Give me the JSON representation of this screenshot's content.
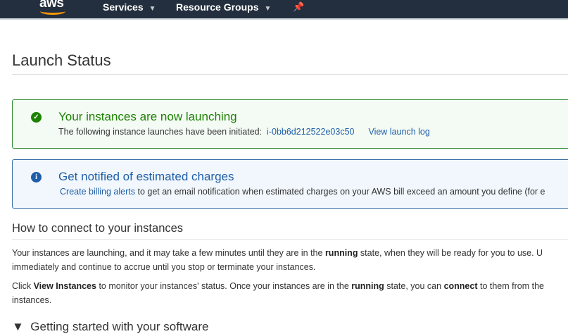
{
  "nav": {
    "logo": "aws",
    "services": "Services",
    "resource_groups": "Resource Groups"
  },
  "page_title": "Launch Status",
  "success": {
    "title": "Your instances are now launching",
    "text": "The following instance launches have been initiated:",
    "instance_id": "i-0bb6d212522e03c50",
    "log_link": "View launch log",
    "color": "#1d8102"
  },
  "billing": {
    "title": "Get notified of estimated charges",
    "link": "Create billing alerts",
    "text": " to get an email notification when estimated charges on your AWS bill exceed an amount you define (for e",
    "color": "#1f5ea8"
  },
  "connect": {
    "heading": "How to connect to your instances",
    "p1a": "Your instances are launching, and it may take a few minutes until they are in the ",
    "p1b": "running",
    "p1c": " state, when they will be ready for you to use. U",
    "p1d": "immediately and continue to accrue until you stop or terminate your instances.",
    "p2a": "Click ",
    "p2b": "View Instances",
    "p2c": " to monitor your instances' status. Once your instances are in the ",
    "p2d": "running",
    "p2e": " state, you can ",
    "p2f": "connect",
    "p2g": " to them from the",
    "p2h": "instances."
  },
  "getting_started": "Getting started with your software"
}
